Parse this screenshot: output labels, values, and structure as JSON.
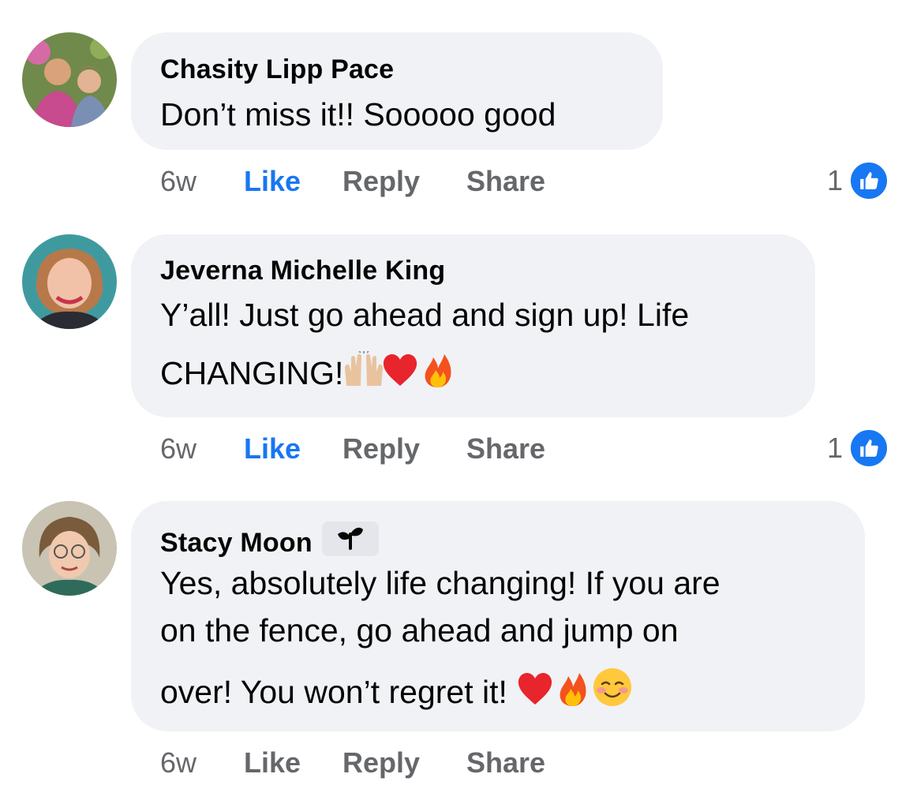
{
  "comments": [
    {
      "author": "Chasity Lipp Pace",
      "lines": [
        "Don’t miss it!! Sooooo good"
      ],
      "time": "6w",
      "like_label": "Like",
      "like_active": true,
      "reply_label": "Reply",
      "share_label": "Share",
      "reaction_count": "1",
      "reaction_icon": "thumbs-up-icon"
    },
    {
      "author": "Jeverna Michelle King",
      "lines": [
        "Y’all! Just go ahead and sign up! Life",
        "CHANGING!"
      ],
      "emojis": [
        "raising-hands-emoji",
        "red-heart-emoji",
        "fire-emoji"
      ],
      "time": "6w",
      "like_label": "Like",
      "like_active": true,
      "reply_label": "Reply",
      "share_label": "Share",
      "reaction_count": "1",
      "reaction_icon": "thumbs-up-icon"
    },
    {
      "author": "Stacy Moon",
      "author_badge": "new-member-sprout-icon",
      "lines": [
        "Yes, absolutely life changing!  If you are",
        "on the fence, go ahead and jump on",
        "over!  You won’t regret it!"
      ],
      "emojis": [
        "red-heart-emoji",
        "fire-emoji",
        "smiling-face-emoji"
      ],
      "time": "6w",
      "like_label": "Like",
      "like_active": false,
      "reply_label": "Reply",
      "share_label": "Share"
    }
  ],
  "colors": {
    "bubble": "#f0f2f5",
    "link_active": "#1877f2",
    "meta_text": "#65676b",
    "reaction_blue": "#1877f2"
  }
}
